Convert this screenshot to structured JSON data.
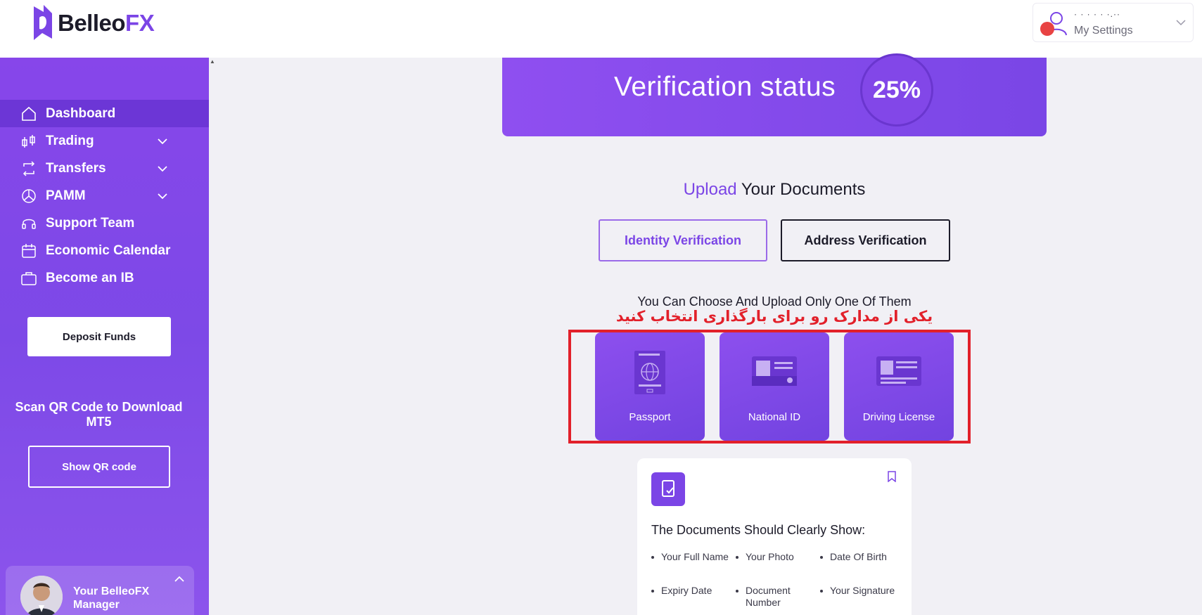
{
  "header": {
    "logo_text_main": "Belleo",
    "logo_text_accent": "FX",
    "user_name": "· ·  ·  · · ·.··",
    "settings_label": "My Settings"
  },
  "sidebar": {
    "items": [
      {
        "label": "Dashboard",
        "icon": "home-icon",
        "active": true
      },
      {
        "label": "Trading",
        "icon": "candlestick-icon",
        "dropdown": true
      },
      {
        "label": "Transfers",
        "icon": "transfer-icon",
        "dropdown": true
      },
      {
        "label": "PAMM",
        "icon": "pie-chart-icon",
        "dropdown": true
      },
      {
        "label": "Support Team",
        "icon": "headset-icon"
      },
      {
        "label": "Economic Calendar",
        "icon": "calendar-icon"
      },
      {
        "label": "Become an IB",
        "icon": "briefcase-icon"
      }
    ],
    "deposit_label": "Deposit Funds",
    "qr_text": "Scan QR Code to Download MT5",
    "qr_button": "Show QR code",
    "manager_label": "Your BelleoFX Manager"
  },
  "verification": {
    "title": "Verification status",
    "percent": "25%"
  },
  "upload": {
    "title_accent": "Upload",
    "title_rest": " Your Documents",
    "tabs": [
      "Identity Verification",
      "Address Verification"
    ],
    "choose_text": "You Can Choose And Upload Only One Of Them",
    "annotation_fa": "یکی از مدارک رو برای بارگذاری انتخاب کنید",
    "documents": [
      {
        "label": "Passport",
        "icon": "passport-icon"
      },
      {
        "label": "National ID",
        "icon": "id-card-icon"
      },
      {
        "label": "Driving License",
        "icon": "license-icon"
      }
    ]
  },
  "info": {
    "title": "The Documents Should Clearly Show:",
    "requirements": [
      "Your Full Name",
      "Your Photo",
      "Date Of Birth",
      "Expiry Date",
      "Document Number",
      "Your Signature"
    ]
  },
  "colors": {
    "accent": "#7b45e6",
    "sidebar": "#8746ea",
    "annotation_red": "#e2202a"
  }
}
